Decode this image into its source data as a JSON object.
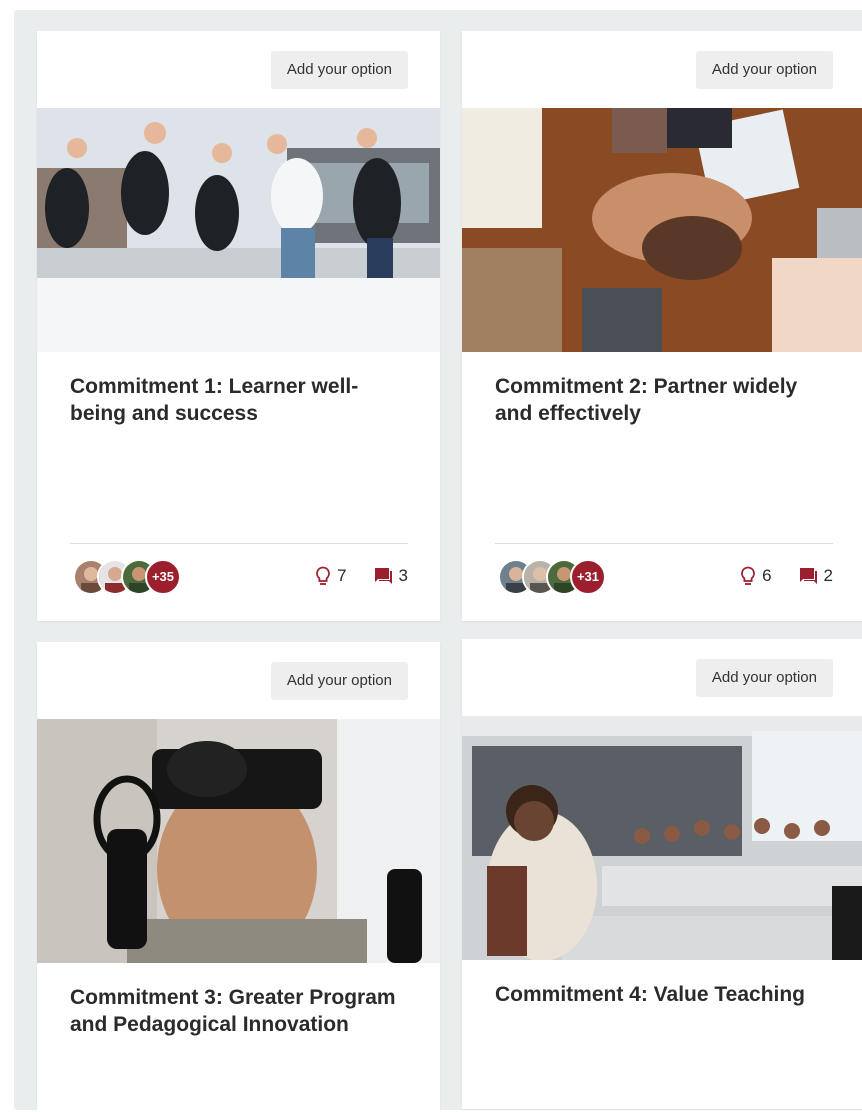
{
  "colors": {
    "accent": "#9c1f2e",
    "board_bg": "#eaeded"
  },
  "cards": [
    {
      "button": "Add your option",
      "title": "Commitment 1: Learner well-being and success",
      "photo": "students jumping in snow",
      "more_count": "+35",
      "ideas": "7",
      "comments": "3"
    },
    {
      "button": "Add your option",
      "title": "Commitment 2: Partner widely and effectively",
      "photo": "hands stacked together",
      "more_count": "+31",
      "ideas": "6",
      "comments": "2"
    },
    {
      "button": "Add your option",
      "title": "Commitment 3: Greater Program and Pedagogical Innovation",
      "photo": "person wearing VR headset"
    },
    {
      "button": "Add your option",
      "title": "Commitment 4: Value Teaching",
      "photo": "instructor teaching a class"
    }
  ],
  "icons": {
    "ideas": "lightbulb-icon",
    "comments": "comment-icon"
  }
}
